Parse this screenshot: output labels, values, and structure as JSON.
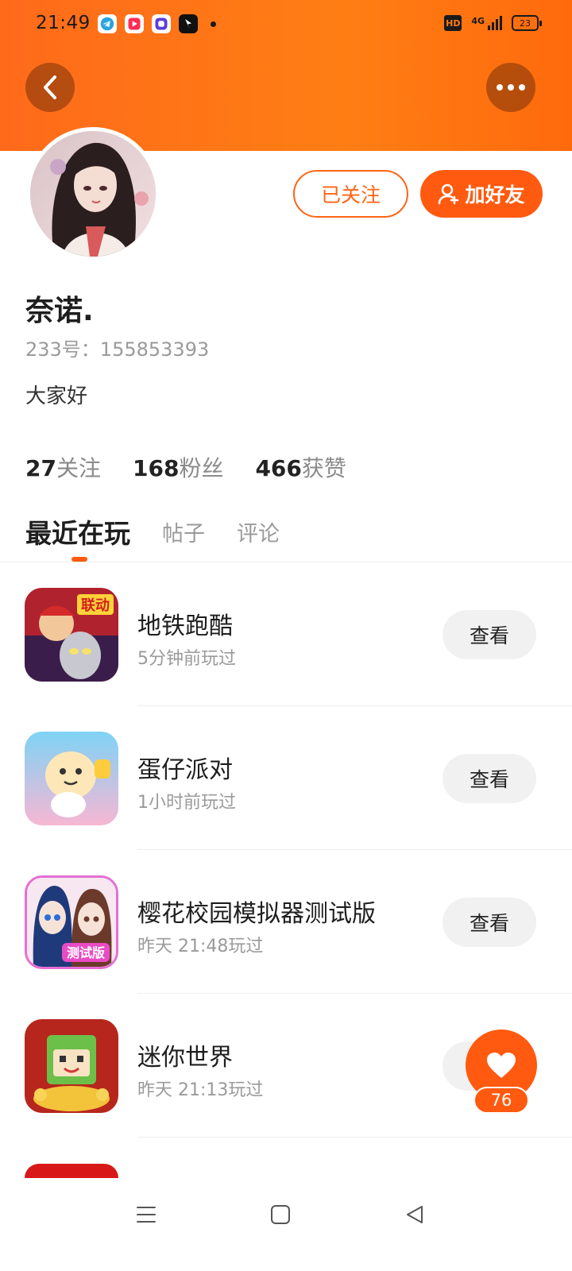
{
  "status_bar": {
    "time": "21:49",
    "network": "4G",
    "hd_label": "HD",
    "battery": "23",
    "app_icons": [
      "telegram-icon",
      "video-icon",
      "browser-icon",
      "app-icon"
    ]
  },
  "header": {
    "back_icon": "chevron-left-icon",
    "more_icon": "more-dots-icon",
    "accent_color": "#ff6a1a"
  },
  "profile": {
    "nickname": "奈诺.",
    "user_id": "233号：155853393",
    "bio": "大家好",
    "follow_label": "已关注",
    "add_friend_label": "加好友"
  },
  "stats": [
    {
      "num": "27",
      "label": "关注"
    },
    {
      "num": "168",
      "label": "粉丝"
    },
    {
      "num": "466",
      "label": "获赞"
    }
  ],
  "tabs": [
    {
      "label": "最近在玩",
      "active": true
    },
    {
      "label": "帖子",
      "active": false
    },
    {
      "label": "评论",
      "active": false
    }
  ],
  "games": [
    {
      "name": "地铁跑酷",
      "time": "5分钟前玩过",
      "button": "查看"
    },
    {
      "name": "蛋仔派对",
      "time": "1小时前玩过",
      "button": "查看"
    },
    {
      "name": "樱花校园模拟器测试版",
      "time": "昨天 21:48玩过",
      "button": "查看"
    },
    {
      "name": "迷你世界",
      "time": "昨天 21:13玩过",
      "button": "查看"
    }
  ],
  "like": {
    "count": "76"
  }
}
